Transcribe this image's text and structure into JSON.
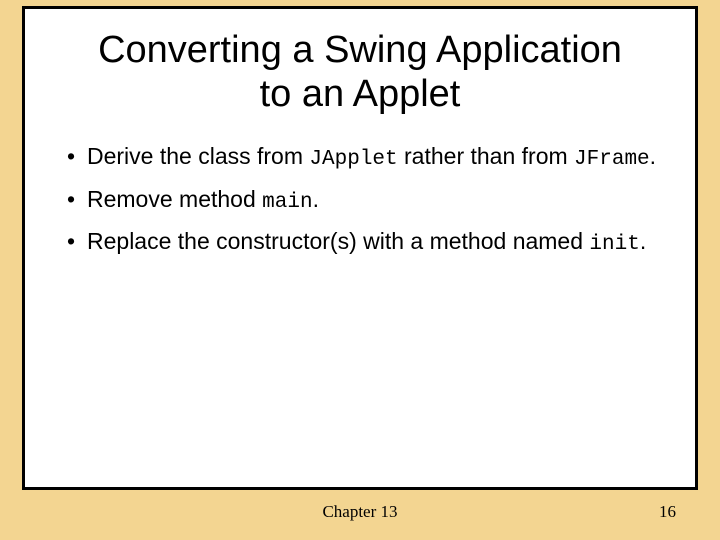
{
  "title": "Converting a Swing Application to an Applet",
  "bullets": {
    "b1_pre": "Derive the class from ",
    "b1_code1": "JApplet",
    "b1_mid": " rather than from ",
    "b1_code2": "JFrame",
    "b1_post": ".",
    "b2_pre": "Remove method ",
    "b2_code": "main",
    "b2_post": ".",
    "b3_pre": "Replace the constructor(s) with a method named ",
    "b3_code": "init",
    "b3_post": "."
  },
  "footer": {
    "chapter": "Chapter 13",
    "page": "16"
  }
}
